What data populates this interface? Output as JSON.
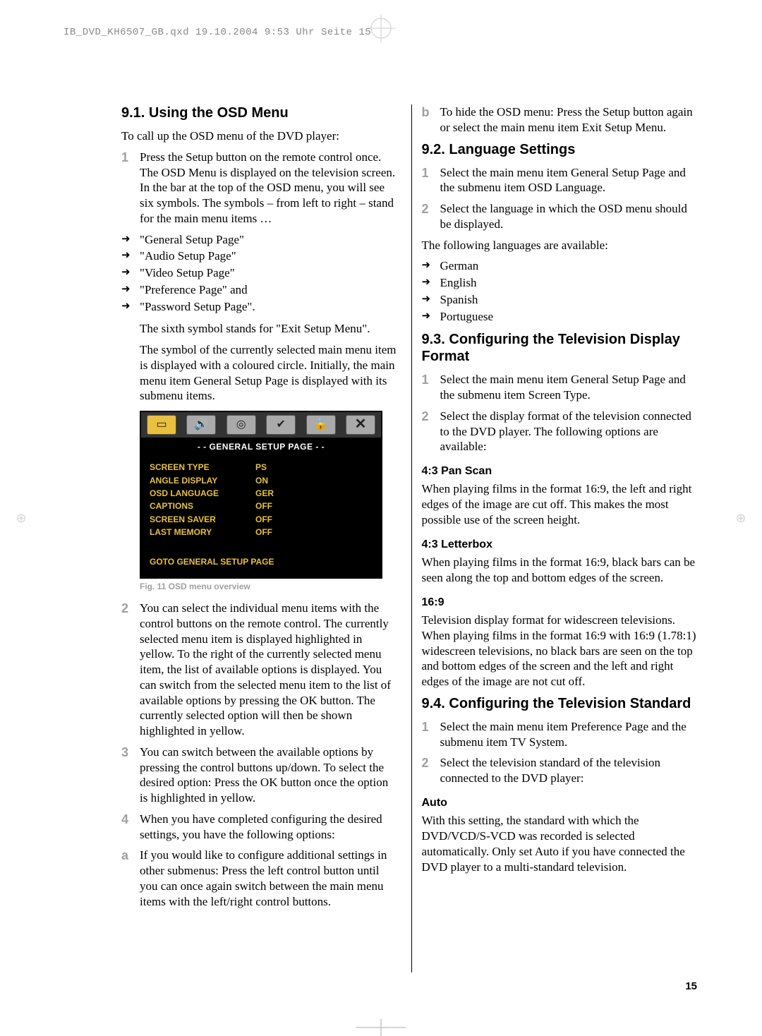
{
  "header_slug": "IB_DVD_KH6507_GB.qxd  19.10.2004  9:53 Uhr  Seite 15",
  "page_number": "15",
  "left": {
    "h1": "9.1. Using the OSD Menu",
    "intro": "To call up the OSD menu of the DVD player:",
    "step1": "Press the Setup button on the remote control once. The OSD Menu is displayed on the television screen. In the bar at the top of the OSD menu, you will see six symbols. The symbols – from left to right – stand for the main menu items …",
    "menu_items": [
      "\"General Setup Page\"",
      "\"Audio Setup Page\"",
      "\"Video Setup Page\"",
      "\"Preference Page\" and",
      "\"Password Setup Page\"."
    ],
    "sixth_symbol": "The sixth symbol stands for \"Exit Setup Menu\".",
    "symbol_note": "The symbol of the currently selected main menu item is displayed with a coloured circle. Initially, the main menu item General Setup Page is displayed with its submenu items.",
    "osd": {
      "title": "- - GENERAL SETUP PAGE - -",
      "rows": [
        {
          "label": "SCREEN TYPE",
          "val": "PS"
        },
        {
          "label": "ANGLE DISPLAY",
          "val": "ON"
        },
        {
          "label": "OSD LANGUAGE",
          "val": "GER"
        },
        {
          "label": "CAPTIONS",
          "val": "OFF"
        },
        {
          "label": "SCREEN SAVER",
          "val": "OFF"
        },
        {
          "label": "LAST MEMORY",
          "val": "OFF"
        }
      ],
      "goto": "GOTO GENERAL SETUP PAGE"
    },
    "fig_caption": "Fig. 11 OSD menu overview",
    "step2": "You can select the individual menu items with the control buttons on the remote control. The currently selected menu item is displayed highlighted in yellow. To the right of the currently selected menu item, the list of available options is displayed. You can switch from the selected menu item to the list of available options by pressing the OK button. The currently selected option will then be shown highlighted in yellow.",
    "step3": "You can switch between the available options by pressing the control buttons up/down. To select the desired option: Press the OK button once the option is highlighted in yellow.",
    "step4": "When you have completed configuring the desired settings, you have the following options:",
    "step_a": "If you would like to configure additional settings in other submenus: Press the left control button until you can once again switch between the main menu items with the left/right control buttons."
  },
  "right": {
    "step_b": "To hide the OSD menu: Press the Setup button again or select the main menu item Exit Setup Menu.",
    "h2_lang": "9.2. Language Settings",
    "lang_step1": "Select the main menu item General Setup Page and the submenu item OSD Language.",
    "lang_step2": "Select the language in which the OSD menu should be displayed.",
    "lang_avail": "The following languages are available:",
    "languages": [
      "German",
      "English",
      "Spanish",
      "Portuguese"
    ],
    "h2_tv": "9.3. Configuring the Television Display Format",
    "tv_step1": "Select the main menu item General Setup Page and the submenu item Screen Type.",
    "tv_step2": "Select the display format of the television connected to the DVD player. The following options are available:",
    "h3_ps": "4:3 Pan Scan",
    "ps_text": "When playing films in the format 16:9, the left and right edges of the image are cut off. This makes the most possible use of the screen height.",
    "h3_lb": "4:3 Letterbox",
    "lb_text": "When playing films in the format 16:9, black bars can be seen along the top and bottom edges of the screen.",
    "h3_169": "16:9",
    "t169_text": "Television display format for widescreen televisions. When playing films in the format 16:9 with 16:9 (1.78:1) widescreen televisions, no black bars are seen on the top and bottom edges of the screen and the left and right edges of the image are not cut off.",
    "h2_std": "9.4. Configuring the Television Standard",
    "std_step1": "Select the main menu item Preference Page and the submenu item TV System.",
    "std_step2": "Select the television standard of the television connected to the DVD player:",
    "h3_auto": "Auto",
    "auto_text": "With this setting, the standard with which the DVD/VCD/S-VCD was recorded is selected automatically. Only set Auto if you have connected the DVD player to a multi-standard television."
  }
}
